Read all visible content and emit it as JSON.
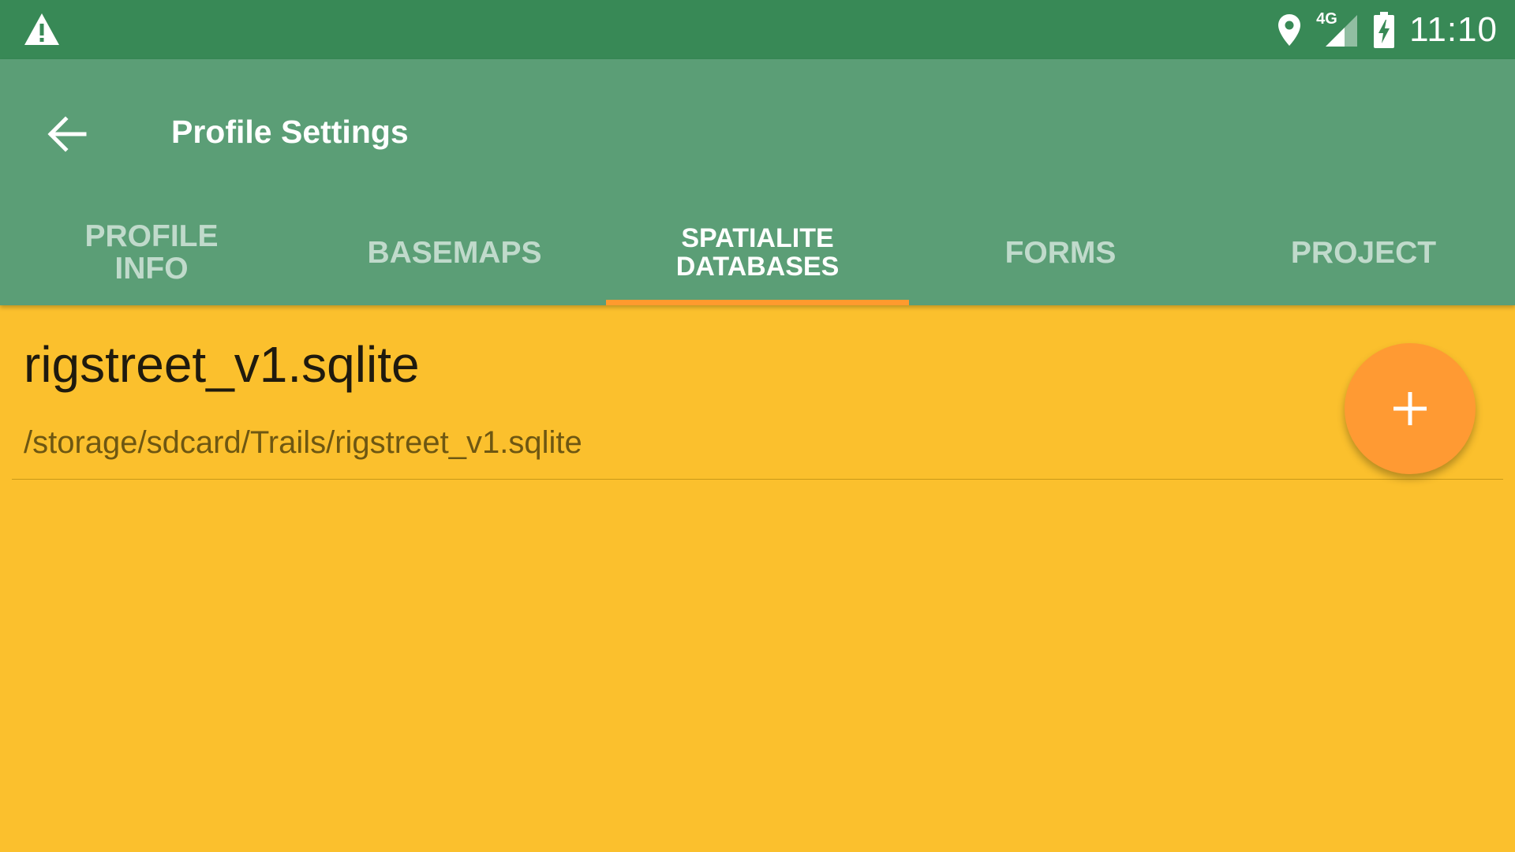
{
  "status_bar": {
    "time": "11:10",
    "network": "4G",
    "icons": [
      "warning-icon",
      "location-pin-icon",
      "signal-icon",
      "battery-charging-icon"
    ]
  },
  "app_bar": {
    "title": "Profile Settings",
    "back_icon": "arrow-back-icon"
  },
  "tabs": [
    {
      "label": "PROFILE INFO",
      "active": false
    },
    {
      "label": "BASEMAPS",
      "active": false
    },
    {
      "label": "SPATIALITE DATABASES",
      "active": true
    },
    {
      "label": "FORMS",
      "active": false
    },
    {
      "label": "PROJECT",
      "active": false
    }
  ],
  "databases": [
    {
      "name": "rigstreet_v1.sqlite",
      "path": "/storage/sdcard/Trails/rigstreet_v1.sqlite"
    }
  ],
  "fab": {
    "icon": "add-icon"
  },
  "colors": {
    "status_bar": "#388956",
    "app_bar": "#5B9E76",
    "background": "#FBC02D",
    "accent": "#FF9A33"
  }
}
